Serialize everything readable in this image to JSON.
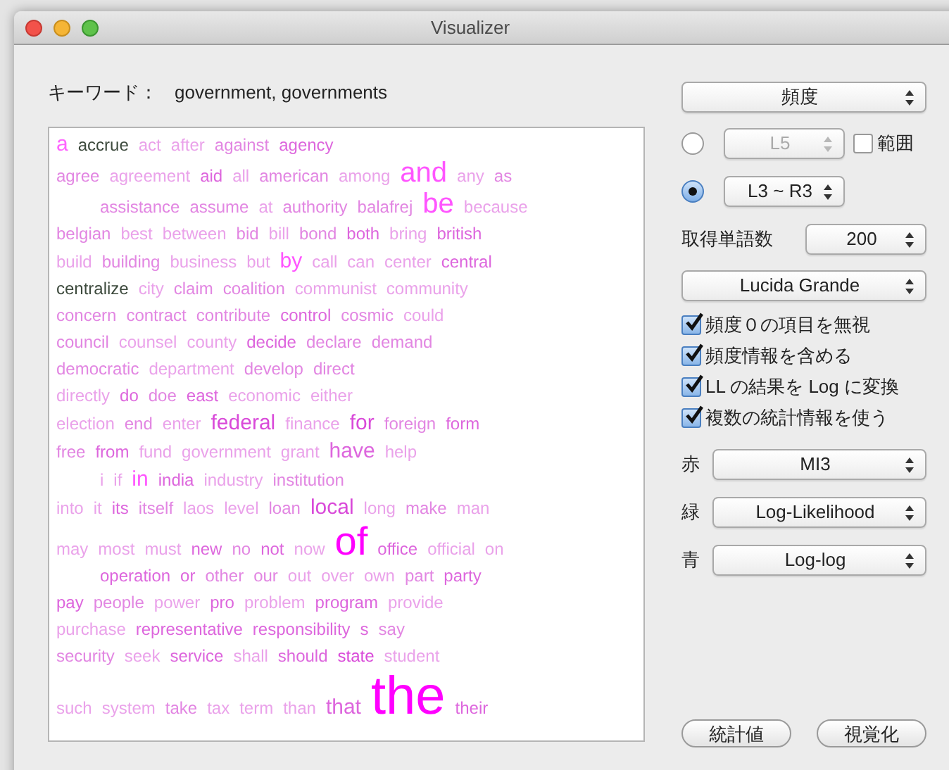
{
  "window": {
    "title": "Visualizer"
  },
  "keyword": {
    "label": "キーワード：",
    "value": "government, governments"
  },
  "cloud": {
    "line_indents": [
      false,
      false,
      true,
      false,
      false,
      false,
      false,
      false,
      false,
      false,
      false,
      false,
      true,
      false,
      false,
      true,
      false,
      false,
      false,
      false
    ],
    "lines": [
      [
        {
          "text": "a",
          "kind": "medium",
          "color": "#ff66ff"
        },
        {
          "text": "accrue",
          "kind": "normal",
          "color": "#3d4a3d"
        },
        {
          "text": "act",
          "kind": "normal",
          "color": "#eaa2ea"
        },
        {
          "text": "after",
          "kind": "normal",
          "color": "#eaa2ea"
        },
        {
          "text": "against",
          "kind": "normal",
          "color": "#e286e2"
        },
        {
          "text": "agency",
          "kind": "normal",
          "color": "#dd66dd"
        }
      ],
      [
        {
          "text": "agree",
          "kind": "normal",
          "color": "#e286e2"
        },
        {
          "text": "agreement",
          "kind": "normal",
          "color": "#eaa2ea"
        },
        {
          "text": "aid",
          "kind": "normal",
          "color": "#dd66dd"
        },
        {
          "text": "all",
          "kind": "normal",
          "color": "#eaa2ea"
        },
        {
          "text": "american",
          "kind": "normal",
          "color": "#e286e2"
        },
        {
          "text": "among",
          "kind": "normal",
          "color": "#eaa2ea"
        },
        {
          "text": "and",
          "kind": "big",
          "color": "#ff55ff"
        },
        {
          "text": "any",
          "kind": "normal",
          "color": "#eaa2ea"
        },
        {
          "text": "as",
          "kind": "normal",
          "color": "#e286e2"
        }
      ],
      [
        {
          "text": "assistance",
          "kind": "normal",
          "color": "#e286e2"
        },
        {
          "text": "assume",
          "kind": "normal",
          "color": "#e286e2"
        },
        {
          "text": "at",
          "kind": "normal",
          "color": "#eaa2ea"
        },
        {
          "text": "authority",
          "kind": "normal",
          "color": "#e286e2"
        },
        {
          "text": "balafrej",
          "kind": "normal",
          "color": "#e286e2"
        },
        {
          "text": "be",
          "kind": "big",
          "color": "#ff55ff"
        },
        {
          "text": "because",
          "kind": "normal",
          "color": "#eaa2ea"
        }
      ],
      [
        {
          "text": "belgian",
          "kind": "normal",
          "color": "#e286e2"
        },
        {
          "text": "best",
          "kind": "normal",
          "color": "#eaa2ea"
        },
        {
          "text": "between",
          "kind": "normal",
          "color": "#eaa2ea"
        },
        {
          "text": "bid",
          "kind": "normal",
          "color": "#e286e2"
        },
        {
          "text": "bill",
          "kind": "normal",
          "color": "#eaa2ea"
        },
        {
          "text": "bond",
          "kind": "normal",
          "color": "#e286e2"
        },
        {
          "text": "both",
          "kind": "normal",
          "color": "#dd66dd"
        },
        {
          "text": "bring",
          "kind": "normal",
          "color": "#eaa2ea"
        },
        {
          "text": "british",
          "kind": "normal",
          "color": "#dd66dd"
        }
      ],
      [
        {
          "text": "build",
          "kind": "normal",
          "color": "#eaa2ea"
        },
        {
          "text": "building",
          "kind": "normal",
          "color": "#e286e2"
        },
        {
          "text": "business",
          "kind": "normal",
          "color": "#eaa2ea"
        },
        {
          "text": "but",
          "kind": "normal",
          "color": "#eaa2ea"
        },
        {
          "text": "by",
          "kind": "medium",
          "color": "#ff55ff"
        },
        {
          "text": "call",
          "kind": "normal",
          "color": "#eaa2ea"
        },
        {
          "text": "can",
          "kind": "normal",
          "color": "#eaa2ea"
        },
        {
          "text": "center",
          "kind": "normal",
          "color": "#eaa2ea"
        },
        {
          "text": "central",
          "kind": "normal",
          "color": "#dd66dd"
        }
      ],
      [
        {
          "text": "centralize",
          "kind": "normal",
          "color": "#3d4a3d"
        },
        {
          "text": "city",
          "kind": "normal",
          "color": "#eaa2ea"
        },
        {
          "text": "claim",
          "kind": "normal",
          "color": "#e286e2"
        },
        {
          "text": "coalition",
          "kind": "normal",
          "color": "#e286e2"
        },
        {
          "text": "communist",
          "kind": "normal",
          "color": "#eaa2ea"
        },
        {
          "text": "community",
          "kind": "normal",
          "color": "#eaa2ea"
        }
      ],
      [
        {
          "text": "concern",
          "kind": "normal",
          "color": "#e286e2"
        },
        {
          "text": "contract",
          "kind": "normal",
          "color": "#e286e2"
        },
        {
          "text": "contribute",
          "kind": "normal",
          "color": "#e286e2"
        },
        {
          "text": "control",
          "kind": "normal",
          "color": "#dd66dd"
        },
        {
          "text": "cosmic",
          "kind": "normal",
          "color": "#e286e2"
        },
        {
          "text": "could",
          "kind": "normal",
          "color": "#eaa2ea"
        }
      ],
      [
        {
          "text": "council",
          "kind": "normal",
          "color": "#e286e2"
        },
        {
          "text": "counsel",
          "kind": "normal",
          "color": "#eaa2ea"
        },
        {
          "text": "county",
          "kind": "normal",
          "color": "#eaa2ea"
        },
        {
          "text": "decide",
          "kind": "normal",
          "color": "#dd66dd"
        },
        {
          "text": "declare",
          "kind": "normal",
          "color": "#e286e2"
        },
        {
          "text": "demand",
          "kind": "normal",
          "color": "#e286e2"
        }
      ],
      [
        {
          "text": "democratic",
          "kind": "normal",
          "color": "#e286e2"
        },
        {
          "text": "department",
          "kind": "normal",
          "color": "#eaa2ea"
        },
        {
          "text": "develop",
          "kind": "normal",
          "color": "#e286e2"
        },
        {
          "text": "direct",
          "kind": "normal",
          "color": "#e286e2"
        }
      ],
      [
        {
          "text": "directly",
          "kind": "normal",
          "color": "#eaa2ea"
        },
        {
          "text": "do",
          "kind": "normal",
          "color": "#dd66dd"
        },
        {
          "text": "doe",
          "kind": "normal",
          "color": "#e286e2"
        },
        {
          "text": "east",
          "kind": "normal",
          "color": "#dd66dd"
        },
        {
          "text": "economic",
          "kind": "normal",
          "color": "#eaa2ea"
        },
        {
          "text": "either",
          "kind": "normal",
          "color": "#eaa2ea"
        }
      ],
      [
        {
          "text": "election",
          "kind": "normal",
          "color": "#eaa2ea"
        },
        {
          "text": "end",
          "kind": "normal",
          "color": "#e286e2"
        },
        {
          "text": "enter",
          "kind": "normal",
          "color": "#eaa2ea"
        },
        {
          "text": "federal",
          "kind": "medium",
          "color": "#d94ad9"
        },
        {
          "text": "finance",
          "kind": "normal",
          "color": "#eaa2ea"
        },
        {
          "text": "for",
          "kind": "medium",
          "color": "#d94ad9"
        },
        {
          "text": "foreign",
          "kind": "normal",
          "color": "#e286e2"
        },
        {
          "text": "form",
          "kind": "normal",
          "color": "#dd66dd"
        }
      ],
      [
        {
          "text": "free",
          "kind": "normal",
          "color": "#e286e2"
        },
        {
          "text": "from",
          "kind": "normal",
          "color": "#dd66dd"
        },
        {
          "text": "fund",
          "kind": "normal",
          "color": "#eaa2ea"
        },
        {
          "text": "government",
          "kind": "normal",
          "color": "#eaa2ea"
        },
        {
          "text": "grant",
          "kind": "normal",
          "color": "#eaa2ea"
        },
        {
          "text": "have",
          "kind": "medium",
          "color": "#dd66dd"
        },
        {
          "text": "help",
          "kind": "normal",
          "color": "#eaa2ea"
        }
      ],
      [
        {
          "text": "i",
          "kind": "normal",
          "color": "#eaa2ea"
        },
        {
          "text": "if",
          "kind": "normal",
          "color": "#eaa2ea"
        },
        {
          "text": "in",
          "kind": "medium",
          "color": "#ff55ff"
        },
        {
          "text": "india",
          "kind": "normal",
          "color": "#dd66dd"
        },
        {
          "text": "industry",
          "kind": "normal",
          "color": "#eaa2ea"
        },
        {
          "text": "institution",
          "kind": "normal",
          "color": "#e286e2"
        }
      ],
      [
        {
          "text": "into",
          "kind": "normal",
          "color": "#eaa2ea"
        },
        {
          "text": "it",
          "kind": "normal",
          "color": "#eaa2ea"
        },
        {
          "text": "its",
          "kind": "normal",
          "color": "#dd66dd"
        },
        {
          "text": "itself",
          "kind": "normal",
          "color": "#e286e2"
        },
        {
          "text": "laos",
          "kind": "normal",
          "color": "#eaa2ea"
        },
        {
          "text": "level",
          "kind": "normal",
          "color": "#eaa2ea"
        },
        {
          "text": "loan",
          "kind": "normal",
          "color": "#e286e2"
        },
        {
          "text": "local",
          "kind": "medium",
          "color": "#d94ad9"
        },
        {
          "text": "long",
          "kind": "normal",
          "color": "#eaa2ea"
        },
        {
          "text": "make",
          "kind": "normal",
          "color": "#e286e2"
        },
        {
          "text": "man",
          "kind": "normal",
          "color": "#eaa2ea"
        }
      ],
      [
        {
          "text": "may",
          "kind": "normal",
          "color": "#eaa2ea"
        },
        {
          "text": "most",
          "kind": "normal",
          "color": "#eaa2ea"
        },
        {
          "text": "must",
          "kind": "normal",
          "color": "#eaa2ea"
        },
        {
          "text": "new",
          "kind": "normal",
          "color": "#dd66dd"
        },
        {
          "text": "no",
          "kind": "normal",
          "color": "#e286e2"
        },
        {
          "text": "not",
          "kind": "normal",
          "color": "#dd66dd"
        },
        {
          "text": "now",
          "kind": "normal",
          "color": "#eaa2ea"
        },
        {
          "text": "of",
          "kind": "large",
          "color": "#ff00ff"
        },
        {
          "text": "office",
          "kind": "normal",
          "color": "#dd66dd"
        },
        {
          "text": "official",
          "kind": "normal",
          "color": "#eaa2ea"
        },
        {
          "text": "on",
          "kind": "normal",
          "color": "#eaa2ea"
        }
      ],
      [
        {
          "text": "operation",
          "kind": "normal",
          "color": "#dd66dd"
        },
        {
          "text": "or",
          "kind": "normal",
          "color": "#dd66dd"
        },
        {
          "text": "other",
          "kind": "normal",
          "color": "#e286e2"
        },
        {
          "text": "our",
          "kind": "normal",
          "color": "#e286e2"
        },
        {
          "text": "out",
          "kind": "normal",
          "color": "#eaa2ea"
        },
        {
          "text": "over",
          "kind": "normal",
          "color": "#eaa2ea"
        },
        {
          "text": "own",
          "kind": "normal",
          "color": "#eaa2ea"
        },
        {
          "text": "part",
          "kind": "normal",
          "color": "#e286e2"
        },
        {
          "text": "party",
          "kind": "normal",
          "color": "#dd66dd"
        }
      ],
      [
        {
          "text": "pay",
          "kind": "normal",
          "color": "#dd66dd"
        },
        {
          "text": "people",
          "kind": "normal",
          "color": "#e286e2"
        },
        {
          "text": "power",
          "kind": "normal",
          "color": "#eaa2ea"
        },
        {
          "text": "pro",
          "kind": "normal",
          "color": "#dd66dd"
        },
        {
          "text": "problem",
          "kind": "normal",
          "color": "#eaa2ea"
        },
        {
          "text": "program",
          "kind": "normal",
          "color": "#dd66dd"
        },
        {
          "text": "provide",
          "kind": "normal",
          "color": "#eaa2ea"
        }
      ],
      [
        {
          "text": "purchase",
          "kind": "normal",
          "color": "#eaa2ea"
        },
        {
          "text": "representative",
          "kind": "normal",
          "color": "#dd66dd"
        },
        {
          "text": "responsibility",
          "kind": "normal",
          "color": "#dd66dd"
        },
        {
          "text": "s",
          "kind": "normal",
          "color": "#dd66dd"
        },
        {
          "text": "say",
          "kind": "normal",
          "color": "#e286e2"
        }
      ],
      [
        {
          "text": "security",
          "kind": "normal",
          "color": "#e286e2"
        },
        {
          "text": "seek",
          "kind": "normal",
          "color": "#eaa2ea"
        },
        {
          "text": "service",
          "kind": "normal",
          "color": "#dd66dd"
        },
        {
          "text": "shall",
          "kind": "normal",
          "color": "#eaa2ea"
        },
        {
          "text": "should",
          "kind": "normal",
          "color": "#dd66dd"
        },
        {
          "text": "state",
          "kind": "normal",
          "color": "#d94ad9"
        },
        {
          "text": "student",
          "kind": "normal",
          "color": "#eaa2ea"
        }
      ],
      [
        {
          "text": "such",
          "kind": "normal",
          "color": "#eaa2ea"
        },
        {
          "text": "system",
          "kind": "normal",
          "color": "#eaa2ea"
        },
        {
          "text": "take",
          "kind": "normal",
          "color": "#e286e2"
        },
        {
          "text": "tax",
          "kind": "normal",
          "color": "#eaa2ea"
        },
        {
          "text": "term",
          "kind": "normal",
          "color": "#eaa2ea"
        },
        {
          "text": "than",
          "kind": "normal",
          "color": "#eaa2ea"
        },
        {
          "text": "that",
          "kind": "medium",
          "color": "#dd66dd"
        },
        {
          "text": "the",
          "kind": "huge",
          "color": "#ff00ff"
        },
        {
          "text": "their",
          "kind": "normal",
          "color": "#dd66dd"
        }
      ]
    ]
  },
  "measure_select": {
    "value": "頻度"
  },
  "span_options": [
    {
      "selected": false,
      "value": "L5",
      "disabled": true,
      "range": {
        "label": "範囲",
        "checked": false
      }
    },
    {
      "selected": true,
      "value": "L3 ~ R3",
      "disabled": false
    }
  ],
  "word_count": {
    "label": "取得単語数",
    "value": "200"
  },
  "font_select": {
    "value": "Lucida Grande"
  },
  "options": [
    {
      "label": "頻度０の項目を無視",
      "checked": true
    },
    {
      "label": "頻度情報を含める",
      "checked": true
    },
    {
      "label": "LL の結果を Log に変換",
      "checked": true
    },
    {
      "label": "複数の統計情報を使う",
      "checked": true
    }
  ],
  "color_channels": [
    {
      "label": "赤",
      "value": "MI3"
    },
    {
      "label": "緑",
      "value": "Log-Likelihood"
    },
    {
      "label": "青",
      "value": "Log-log"
    }
  ],
  "buttons": [
    "統計値",
    "視覚化"
  ]
}
